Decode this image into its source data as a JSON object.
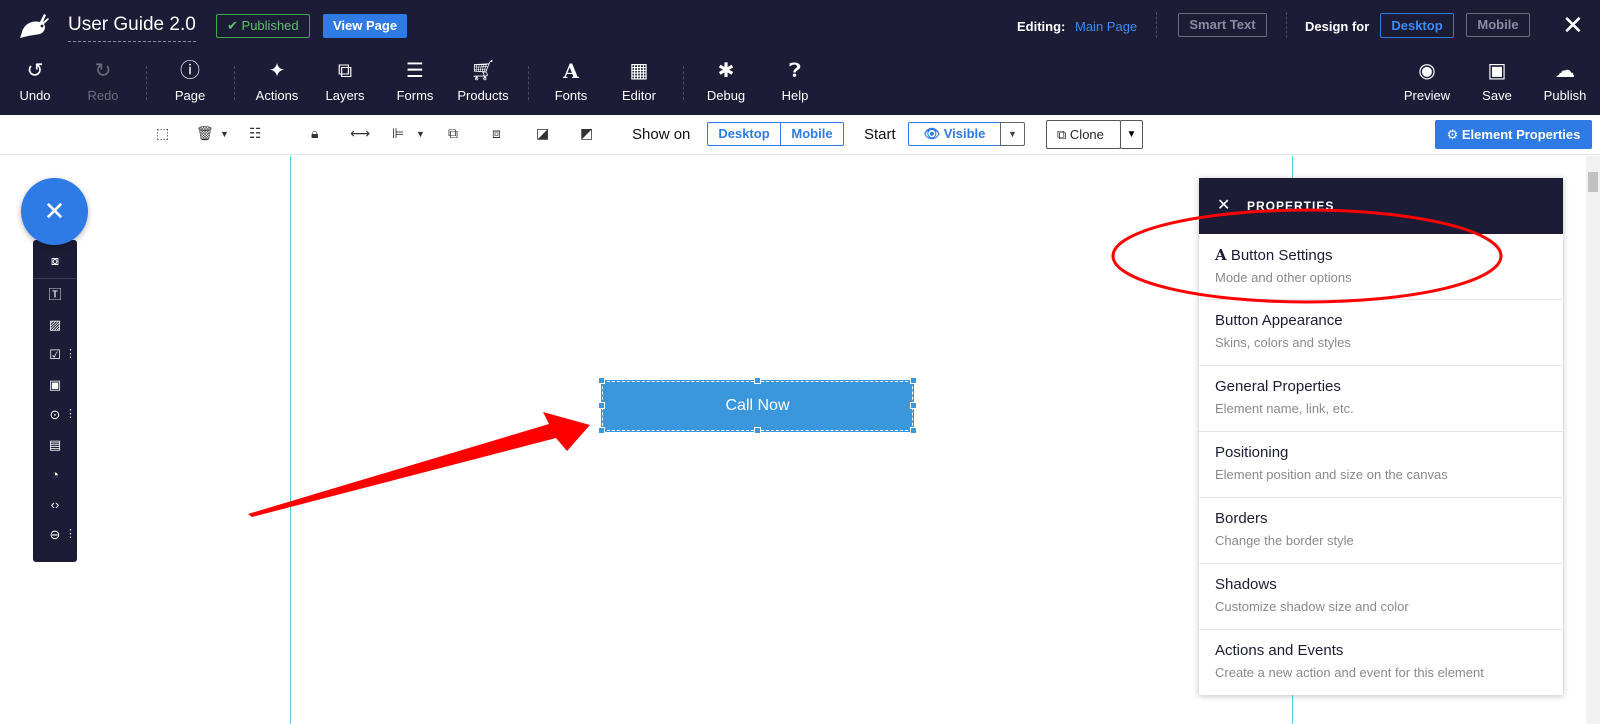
{
  "header": {
    "title": "User Guide 2.0",
    "published_label": "Published",
    "view_page_label": "View Page",
    "editing_label": "Editing:",
    "editing_page": "Main Page",
    "smart_text_label": "Smart Text",
    "design_for_label": "Design for",
    "desktop_label": "Desktop",
    "mobile_label": "Mobile"
  },
  "toolbar": {
    "left": [
      {
        "label": "Undo",
        "icon": "undo-icon"
      },
      {
        "label": "Redo",
        "icon": "redo-icon"
      },
      {
        "label": "Page",
        "icon": "info-icon"
      },
      {
        "label": "Actions",
        "icon": "magic-wand-icon"
      },
      {
        "label": "Layers",
        "icon": "layers-icon"
      },
      {
        "label": "Forms",
        "icon": "list-icon"
      },
      {
        "label": "Products",
        "icon": "cart-icon"
      },
      {
        "label": "Fonts",
        "icon": "font-icon"
      },
      {
        "label": "Editor",
        "icon": "grid-icon"
      },
      {
        "label": "Debug",
        "icon": "bug-icon"
      },
      {
        "label": "Help",
        "icon": "question-icon"
      }
    ],
    "right": [
      {
        "label": "Preview",
        "icon": "eye-icon"
      },
      {
        "label": "Save",
        "icon": "floppy-icon"
      },
      {
        "label": "Publish",
        "icon": "cloud-upload-icon"
      }
    ]
  },
  "subbar": {
    "show_on_label": "Show on",
    "show_desktop": "Desktop",
    "show_mobile": "Mobile",
    "start_label": "Start",
    "visible_label": "Visible",
    "clone_label": "Clone",
    "element_properties_label": "Element Properties"
  },
  "canvas": {
    "button_label": "Call Now"
  },
  "properties": {
    "header": "PROPERTIES",
    "items": [
      {
        "title": "Button Settings",
        "subtitle": "Mode and other options"
      },
      {
        "title": "Button Appearance",
        "subtitle": "Skins, colors and styles"
      },
      {
        "title": "General Properties",
        "subtitle": "Element name, link, etc."
      },
      {
        "title": "Positioning",
        "subtitle": "Element position and size on the canvas"
      },
      {
        "title": "Borders",
        "subtitle": "Change the border style"
      },
      {
        "title": "Shadows",
        "subtitle": "Customize shadow size and color"
      },
      {
        "title": "Actions and Events",
        "subtitle": "Create a new action and event for this element"
      }
    ]
  },
  "colors": {
    "topbar": "#1c1c36",
    "accent": "#2e7be6",
    "cta_button": "#3a97db",
    "annotation": "#ff0000"
  }
}
